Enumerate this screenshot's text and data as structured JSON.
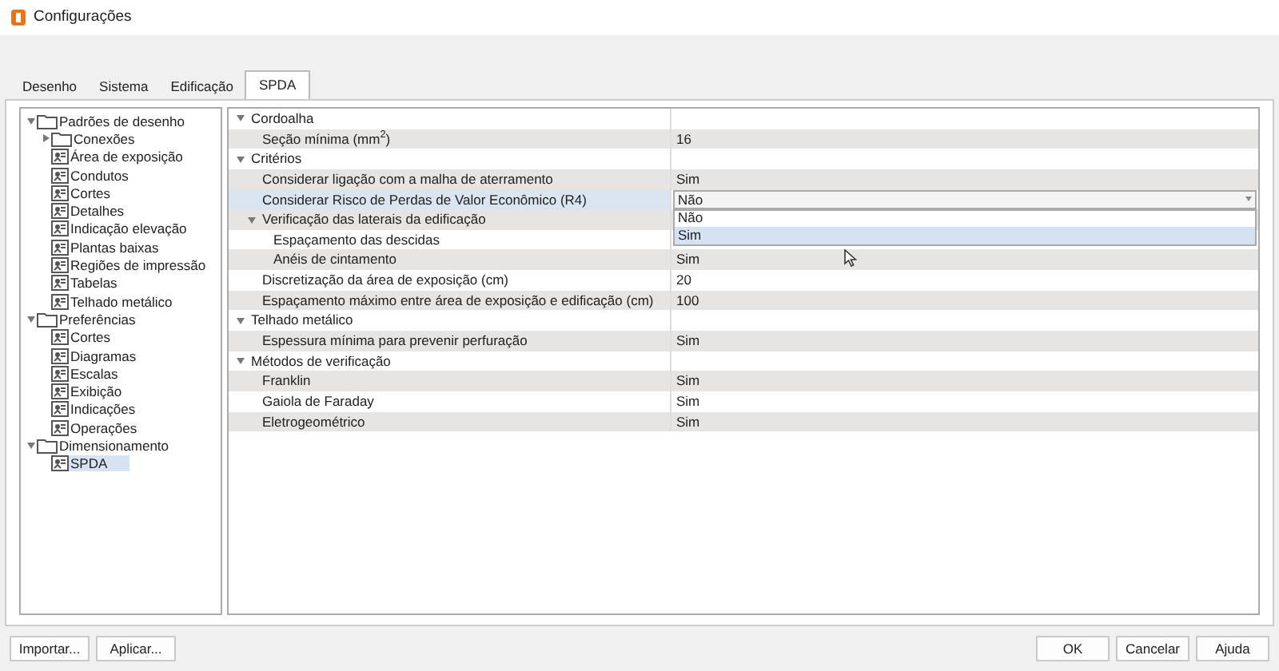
{
  "window": {
    "title": "Configurações"
  },
  "tabs": [
    {
      "label": "Desenho",
      "selected": false
    },
    {
      "label": "Sistema",
      "selected": false
    },
    {
      "label": "Edificação",
      "selected": false
    },
    {
      "label": "SPDA",
      "selected": true
    }
  ],
  "tree": [
    {
      "label": "Padrões de desenho",
      "kind": "folder",
      "expanded": true,
      "selected": false,
      "children": [
        {
          "label": "Conexões",
          "kind": "folder",
          "expanded": false,
          "selected": false
        },
        {
          "label": "Área de exposição",
          "kind": "page",
          "selected": false
        },
        {
          "label": "Condutos",
          "kind": "page",
          "selected": false
        },
        {
          "label": "Cortes",
          "kind": "page",
          "selected": false
        },
        {
          "label": "Detalhes",
          "kind": "page",
          "selected": false
        },
        {
          "label": "Indicação elevação",
          "kind": "page",
          "selected": false
        },
        {
          "label": "Plantas baixas",
          "kind": "page",
          "selected": false
        },
        {
          "label": "Regiões de impressão",
          "kind": "page",
          "selected": false
        },
        {
          "label": "Tabelas",
          "kind": "page",
          "selected": false
        },
        {
          "label": "Telhado metálico",
          "kind": "page",
          "selected": false
        }
      ]
    },
    {
      "label": "Preferências",
      "kind": "folder",
      "expanded": true,
      "selected": false,
      "children": [
        {
          "label": "Cortes",
          "kind": "page",
          "selected": false
        },
        {
          "label": "Diagramas",
          "kind": "page",
          "selected": false
        },
        {
          "label": "Escalas",
          "kind": "page",
          "selected": false
        },
        {
          "label": "Exibição",
          "kind": "page",
          "selected": false
        },
        {
          "label": "Indicações",
          "kind": "page",
          "selected": false
        },
        {
          "label": "Operações",
          "kind": "page",
          "selected": false
        }
      ]
    },
    {
      "label": "Dimensionamento",
      "kind": "folder",
      "expanded": true,
      "selected": false,
      "children": [
        {
          "label": "SPDA",
          "kind": "page",
          "selected": true
        }
      ]
    }
  ],
  "properties": [
    {
      "label": "Cordoalha",
      "expanded": true,
      "children": [
        {
          "label": "Seção mínima (mm$^{2}$)",
          "value": "16",
          "selected": false
        }
      ]
    },
    {
      "label": "Critérios",
      "expanded": true,
      "children": [
        {
          "label": "Considerar ligação com a malha de aterramento",
          "value": "Sim",
          "selected": false
        },
        {
          "label": "Considerar Risco de Perdas de Valor Econômico (R4)",
          "value": "Não",
          "selected": true,
          "dropdown": {
            "options": [
              {
                "label": "Não",
                "selected": false
              },
              {
                "label": "Sim",
                "selected": true
              }
            ]
          }
        },
        {
          "label": "Verificação das laterais da edificação",
          "expanded": true,
          "children": [
            {
              "label": "Espaçamento das descidas",
              "selected": false
            },
            {
              "label": "Anéis de cintamento",
              "value": "Sim",
              "selected": false
            }
          ]
        },
        {
          "label": "Discretização da área de exposição (cm)",
          "value": "20",
          "selected": false
        },
        {
          "label": "Espaçamento máximo entre área de exposição e edificação (cm)",
          "value": "100",
          "selected": false
        }
      ]
    },
    {
      "label": "Telhado metálico",
      "expanded": true,
      "children": [
        {
          "label": "Espessura mínima para prevenir perfuração",
          "value": "Sim",
          "selected": false
        }
      ]
    },
    {
      "label": "Métodos de verificação",
      "expanded": true,
      "children": [
        {
          "label": "Franklin",
          "value": "Sim",
          "selected": false
        },
        {
          "label": "Gaiola de Faraday",
          "value": "Sim",
          "selected": false
        },
        {
          "label": "Eletrogeométrico",
          "value": "Sim",
          "selected": false
        }
      ]
    }
  ],
  "left_buttons": [
    "Importar...",
    "Aplicar..."
  ],
  "right_buttons": [
    "OK",
    "Cancelar",
    "Ajuda"
  ]
}
